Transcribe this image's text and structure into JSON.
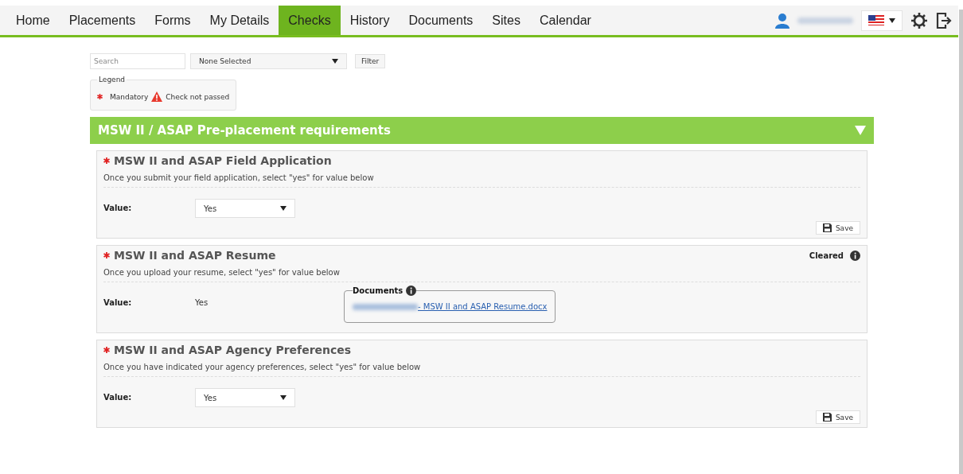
{
  "nav": {
    "tabs": [
      {
        "label": "Home",
        "selected": false
      },
      {
        "label": "Placements",
        "selected": false
      },
      {
        "label": "Forms",
        "selected": false
      },
      {
        "label": "My Details",
        "selected": false
      },
      {
        "label": "Checks",
        "selected": true
      },
      {
        "label": "History",
        "selected": false
      },
      {
        "label": "Documents",
        "selected": false
      },
      {
        "label": "Sites",
        "selected": false
      },
      {
        "label": "Calendar",
        "selected": false
      }
    ]
  },
  "filters": {
    "search": {
      "placeholder": "Search"
    },
    "select": {
      "value": "None Selected"
    },
    "button": "Filter"
  },
  "legend": {
    "title": "Legend",
    "items": [
      {
        "kind": "mandatory",
        "label": "Mandatory"
      },
      {
        "kind": "warning",
        "label": "Check not passed"
      }
    ]
  },
  "group": {
    "title": "MSW II / ASAP Pre-placement requirements",
    "expanded": true
  },
  "checks": [
    {
      "kind": "select",
      "mandatory": true,
      "title": "MSW II and ASAP Field Application",
      "description": "Once you submit your field application, select \"yes\" for value below",
      "value_label": "Value:",
      "value": "Yes",
      "save": "Save"
    },
    {
      "kind": "readonly",
      "mandatory": true,
      "title": "MSW II and ASAP Resume",
      "description": "Once you upload your resume, select \"yes\" for value below",
      "value_label": "Value:",
      "value": "Yes",
      "status": "Cleared",
      "documents": {
        "title": "Documents",
        "files": [
          "- MSW II and ASAP Resume.docx"
        ]
      }
    },
    {
      "kind": "select",
      "mandatory": true,
      "title": "MSW II and ASAP Agency Preferences",
      "description": "Once you have indicated your agency preferences, select \"yes\" for value below",
      "value_label": "Value:",
      "value": "Yes",
      "save": "Save"
    }
  ]
}
